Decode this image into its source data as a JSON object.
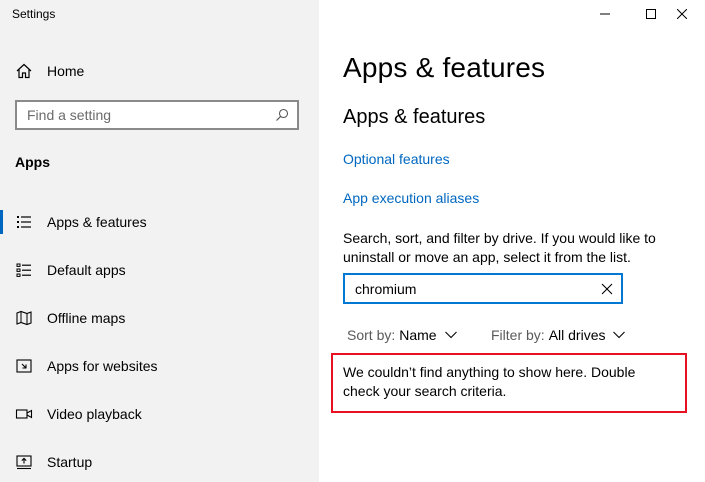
{
  "window": {
    "title": "Settings",
    "controls": [
      "minimize-icon",
      "maximize-icon",
      "close-icon"
    ]
  },
  "sidebar": {
    "home_label": "Home",
    "search_placeholder": "Find a setting",
    "section_title": "Apps",
    "items": [
      {
        "label": "Apps & features",
        "icon": "apps-features-icon",
        "selected": true
      },
      {
        "label": "Default apps",
        "icon": "default-apps-icon",
        "selected": false
      },
      {
        "label": "Offline maps",
        "icon": "offline-maps-icon",
        "selected": false
      },
      {
        "label": "Apps for websites",
        "icon": "apps-websites-icon",
        "selected": false
      },
      {
        "label": "Video playback",
        "icon": "video-playback-icon",
        "selected": false
      },
      {
        "label": "Startup",
        "icon": "startup-icon",
        "selected": false
      }
    ]
  },
  "main": {
    "page_title": "Apps & features",
    "section_title": "Apps & features",
    "links": {
      "optional_features": "Optional features",
      "app_execution_aliases": "App execution aliases"
    },
    "description": "Search, sort, and filter by drive. If you would like to uninstall or move an app, select it from the list.",
    "search_value": "chromium",
    "sort": {
      "label": "Sort by:",
      "value": "Name"
    },
    "filter": {
      "label": "Filter by:",
      "value": "All drives"
    },
    "empty_message": "We couldn’t find anything to show here. Double check your search criteria."
  },
  "colors": {
    "accent": "#0067c0",
    "highlight_border": "#e81123",
    "sidebar_bg": "#f2f2f2"
  }
}
